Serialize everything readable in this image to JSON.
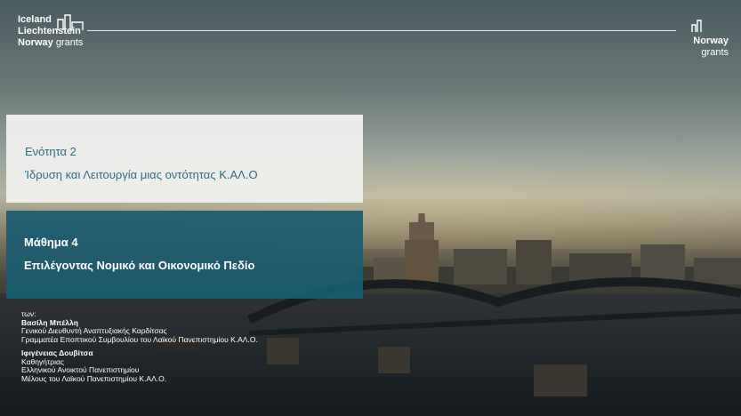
{
  "logo_left": {
    "line1": "Iceland",
    "line2": "Liechtenstein",
    "line3_bold": "Norway",
    "line3_light": "grants"
  },
  "logo_right": {
    "line1": "Norway",
    "line2": "grants"
  },
  "section": {
    "label": "Ενότητα 2",
    "title": "Ίδρυση και Λειτουργία μιας οντότητας Κ.ΑΛ.Ο"
  },
  "lesson": {
    "label": "Μάθημα 4",
    "title": "Επιλέγοντας Νομικό και Οικονομικό Πεδίο"
  },
  "credits": {
    "intro": "των:",
    "author1_name": "Βασίλη Μπέλλη",
    "author1_role1": "Γενικού Διευθυντή Αναπτυξιακής Καρδίτσας",
    "author1_role2": "Γραμματέα Εποπτικού Συμβουλίου του Λαϊκού Πανεπιστημίου Κ.ΑΛ.Ο.",
    "author2_name": "Ιφιγένειας Δουβίτσα",
    "author2_role1": "Καθηγήτριας",
    "author2_role2": "Ελληνικού Ανοικτού Πανεπιστημίου",
    "author2_role3": "Μέλους του Λαϊκού Πανεπιστημίου Κ.ΑΛ.Ο."
  }
}
